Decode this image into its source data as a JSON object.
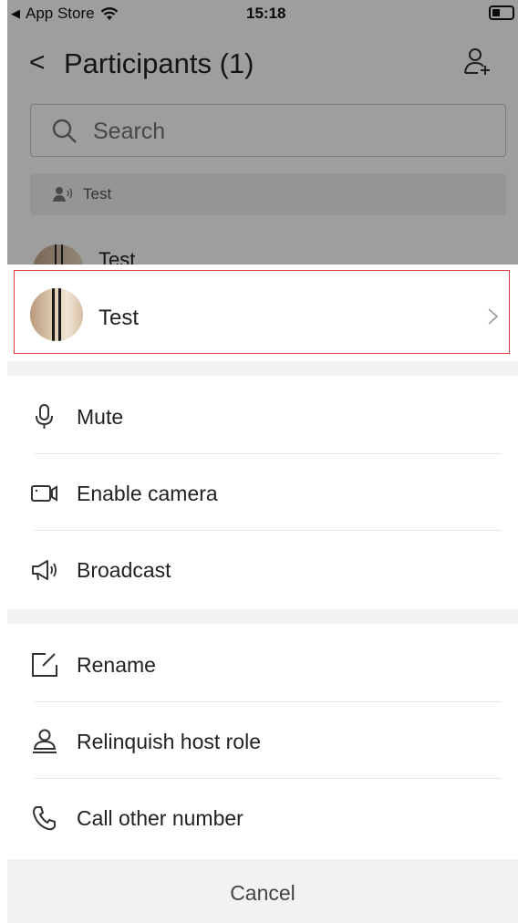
{
  "status_bar": {
    "back_app": "App Store",
    "time": "15:18"
  },
  "nav": {
    "title": "Participants (1)"
  },
  "search": {
    "placeholder": "Search"
  },
  "speaker": {
    "name": "Test"
  },
  "background_row": {
    "name": "Test"
  },
  "sheet": {
    "participant_name": "Test",
    "group1": [
      {
        "label": "Mute",
        "icon": "microphone-icon"
      },
      {
        "label": "Enable camera",
        "icon": "camera-icon"
      },
      {
        "label": "Broadcast",
        "icon": "megaphone-icon"
      }
    ],
    "group2": [
      {
        "label": "Rename",
        "icon": "rename-icon"
      },
      {
        "label": "Relinquish host role",
        "icon": "host-icon"
      },
      {
        "label": "Call other number",
        "icon": "phone-icon"
      }
    ],
    "cancel_label": "Cancel"
  },
  "colors": {
    "highlight_border": "#d63b3b",
    "divider": "#f2f2f4"
  }
}
